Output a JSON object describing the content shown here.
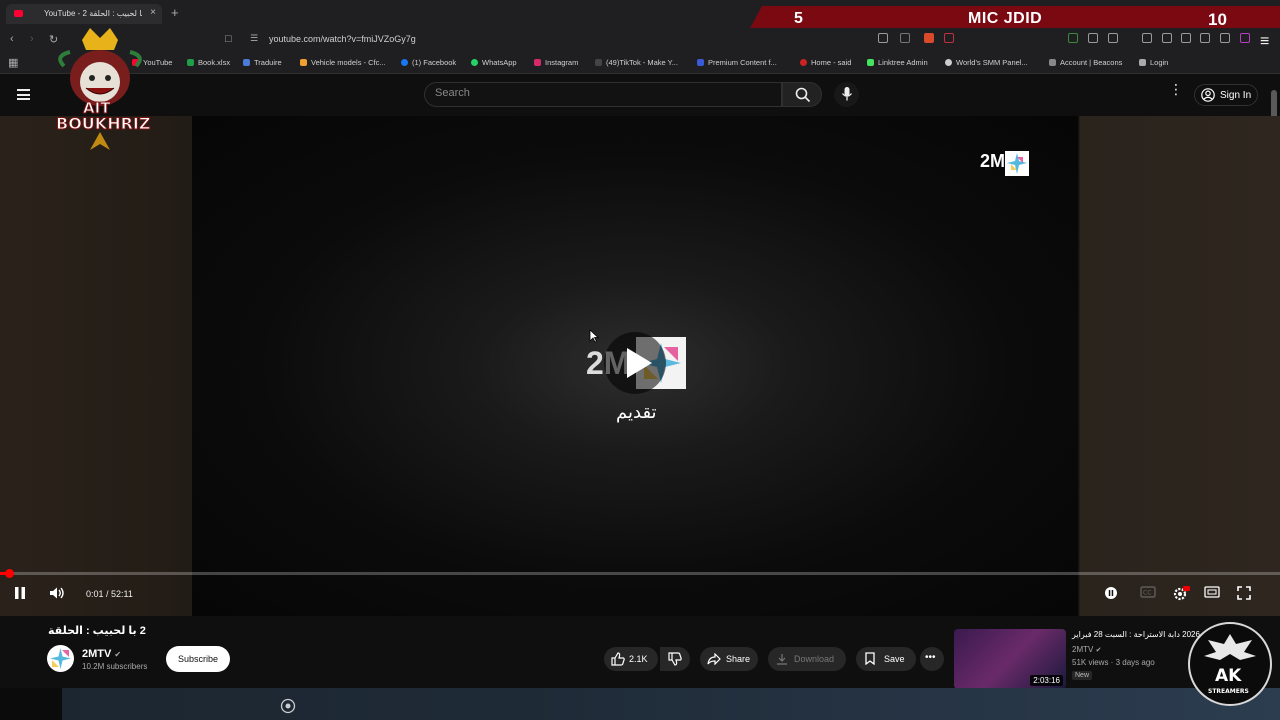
{
  "browser": {
    "tab_title": "YouTube - 2 با لحبيب : الحلقة",
    "url": "youtube.com/watch?v=fmiJVZoGy7g",
    "bookmarks": [
      {
        "label": "YouTube",
        "color": "#ff0033"
      },
      {
        "label": "Book.xlsx",
        "color": "#1e9e48"
      },
      {
        "label": "Traduire",
        "color": "#4a7bd8"
      },
      {
        "label": "Vehicle models - Cfc...",
        "color": "#f0a030"
      },
      {
        "label": "(1) Facebook",
        "color": "#1877f2"
      },
      {
        "label": "WhatsApp",
        "color": "#25d366"
      },
      {
        "label": "Instagram",
        "color": "#d6296a"
      },
      {
        "label": "(49)TikTok - Make Y...",
        "color": "#222222"
      },
      {
        "label": "Premium Content f...",
        "color": "#3a5bd8"
      },
      {
        "label": "Home - said",
        "color": "#cc2222"
      },
      {
        "label": "Linktree Admin",
        "color": "#43e55e"
      },
      {
        "label": "World's SMM Panel...",
        "color": "#cccccc"
      },
      {
        "label": "Account | Beacons",
        "color": "#888888"
      },
      {
        "label": "Login",
        "color": "#aaaaaa"
      }
    ]
  },
  "stream_banner": {
    "left_number": "5",
    "title": "MIC JDID",
    "right_number": "10"
  },
  "overlay_logos": {
    "left_line1": "AIT",
    "left_line2": "BOUKHRIZ",
    "right_line1": "AK",
    "right_line2": "STREAMERS"
  },
  "youtube": {
    "search_placeholder": "Search",
    "sign_in": "Sign In"
  },
  "player": {
    "watermark": "2M",
    "center_logo": "2M",
    "subtitle": "تقديم",
    "time_display": "0:01 / 52:11",
    "progress_fraction": 0.006
  },
  "video": {
    "title": "2 با لحبيب : الحلقة",
    "channel": "2MTV",
    "subscribers": "10.2M subscribers",
    "subscribe_label": "Subscribe",
    "likes": "2.1K",
    "share_label": "Share",
    "download_label": "Download",
    "save_label": "Save"
  },
  "recommendation": {
    "title": "2026 دابة الاستراحة : السبت 28 فبراير",
    "channel": "2MTV",
    "views": "51K views · 3 days ago",
    "badge": "New",
    "duration": "2:03:16"
  },
  "colors": {
    "youtube_red": "#ff0000",
    "banner_red": "#7a0912",
    "background": "#0f0f0f"
  }
}
